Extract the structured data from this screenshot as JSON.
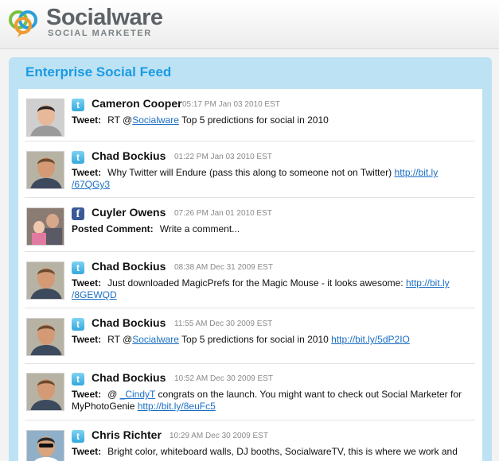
{
  "brand": {
    "name": "Socialware",
    "tagline": "SOCIAL MARKETER",
    "colors": {
      "green": "#7ac043",
      "blue": "#2a9fd8",
      "orange": "#f29a2e"
    }
  },
  "panel": {
    "title": "Enterprise Social Feed"
  },
  "feed": [
    {
      "author": "Cameron Cooper",
      "time": "05:17 PM Jan 03 2010 EST",
      "source": "twitter-icon",
      "kind": "Tweet:",
      "parts": [
        {
          "t": "RT @"
        },
        {
          "link": "Socialware"
        },
        {
          "t": " Top 5 predictions for social in 2010"
        }
      ]
    },
    {
      "author": "Chad Bockius",
      "time": "01:22 PM Jan 03 2010 EST",
      "source": "twitter-icon",
      "kind": "Tweet:",
      "parts": [
        {
          "t": "Why Twitter will Endure (pass this along to someone not on Twitter) "
        },
        {
          "link": "http://bit.ly"
        },
        {
          "br": true
        },
        {
          "link": "/67QGy3"
        }
      ]
    },
    {
      "author": "Cuyler Owens",
      "time": "07:26 PM Jan 01 2010 EST",
      "source": "facebook-icon",
      "kind": "Posted Comment:",
      "parts": [
        {
          "t": "Write a comment..."
        }
      ]
    },
    {
      "author": "Chad Bockius",
      "time": "08:38 AM Dec 31 2009 EST",
      "source": "twitter-icon",
      "kind": "Tweet:",
      "parts": [
        {
          "t": "Just downloaded MagicPrefs for the Magic Mouse - it looks awesome: "
        },
        {
          "link": "http://bit.ly"
        },
        {
          "br": true
        },
        {
          "link": "/8GEWQD"
        }
      ]
    },
    {
      "author": "Chad Bockius",
      "time": "11:55 AM Dec 30 2009 EST",
      "source": "twitter-icon",
      "kind": "Tweet:",
      "parts": [
        {
          "t": "RT @"
        },
        {
          "link": "Socialware"
        },
        {
          "t": " Top 5 predictions for social in 2010 "
        },
        {
          "link": "http://bit.ly/5dP2IO"
        }
      ]
    },
    {
      "author": "Chad Bockius",
      "time": "10:52 AM Dec 30 2009 EST",
      "source": "twitter-icon",
      "kind": "Tweet:",
      "parts": [
        {
          "t": "@ "
        },
        {
          "link": "_CindyT"
        },
        {
          "t": " congrats on the launch. You might want to check out Social Marketer for MyPhotoGenie "
        },
        {
          "link": "http://bit.ly/8euFc5"
        }
      ]
    },
    {
      "author": "Chris Richter",
      "time": "10:29 AM Dec 30 2009 EST",
      "source": "twitter-icon",
      "kind": "Tweet:",
      "parts": [
        {
          "t": "Bright color, whiteboard walls, DJ booths, SocialwareTV, this is where we work and"
        }
      ]
    }
  ]
}
